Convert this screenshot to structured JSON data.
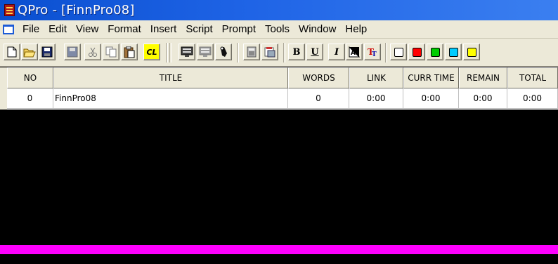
{
  "window": {
    "title": "QPro - [FinnPro08]"
  },
  "menu": {
    "items": [
      "File",
      "Edit",
      "View",
      "Format",
      "Insert",
      "Script",
      "Prompt",
      "Tools",
      "Window",
      "Help"
    ]
  },
  "toolbar": {
    "cl_label": "CL",
    "bold_label": "B",
    "underline_label": "U",
    "italic_label": "I",
    "swatches": [
      "#ffffff",
      "#ff0000",
      "#00cc00",
      "#00ccff",
      "#ffff00"
    ]
  },
  "grid": {
    "columns": [
      "NO",
      "TITLE",
      "WORDS",
      "LINK",
      "CURR TIME",
      "REMAIN",
      "TOTAL"
    ],
    "rows": [
      {
        "no": "0",
        "title": "FinnPro08",
        "words": "0",
        "link": "0:00",
        "curr_time": "0:00",
        "remain": "0:00",
        "total": "0:00"
      }
    ]
  },
  "colors": {
    "titlebar": "#1f64e6",
    "cue_line": "#ff00ff",
    "editor_bg": "#000000"
  }
}
